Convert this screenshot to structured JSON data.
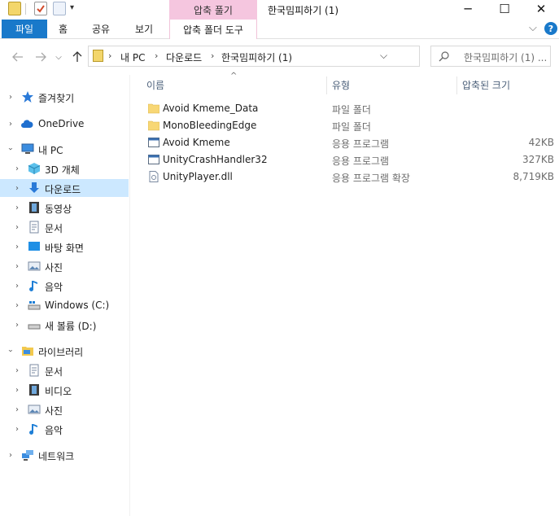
{
  "window": {
    "title": "한국밈피하기 (1)",
    "contextual_group": "압축 풀기",
    "controls": {
      "minimize": "─",
      "maximize": "☐",
      "close": "✕"
    }
  },
  "ribbon": {
    "tabs": [
      "파일",
      "홈",
      "공유",
      "보기"
    ],
    "context_tab": "압축 폴더 도구",
    "collapse_glyph": "⌵",
    "help_glyph": "?"
  },
  "address": {
    "crumbs": [
      "내 PC",
      "다운로드",
      "한국밈피하기 (1)"
    ],
    "separator": "›",
    "search_placeholder": "한국밈피하기 (1) ..."
  },
  "nav": {
    "quick_access": "즐겨찾기",
    "onedrive": "OneDrive",
    "this_pc": "내 PC",
    "pc_items": [
      "3D 개체",
      "다운로드",
      "동영상",
      "문서",
      "바탕 화면",
      "사진",
      "음악",
      "Windows (C:)",
      "새 볼륨 (D:)"
    ],
    "libraries": "라이브러리",
    "lib_items": [
      "문서",
      "비디오",
      "사진",
      "음악"
    ],
    "network": "네트워크"
  },
  "columns": {
    "name": "이름",
    "type": "유형",
    "size": "압축된 크기"
  },
  "files": [
    {
      "name": "Avoid Kmeme_Data",
      "type": "파일 폴더",
      "size": "",
      "icon": "folder-icon"
    },
    {
      "name": "MonoBleedingEdge",
      "type": "파일 폴더",
      "size": "",
      "icon": "folder-icon"
    },
    {
      "name": "Avoid Kmeme",
      "type": "응용 프로그램",
      "size": "42KB",
      "icon": "application-icon"
    },
    {
      "name": "UnityCrashHandler32",
      "type": "응용 프로그램",
      "size": "327KB",
      "icon": "application-icon"
    },
    {
      "name": "UnityPlayer.dll",
      "type": "응용 프로그램 확장",
      "size": "8,719KB",
      "icon": "dll-icon"
    }
  ],
  "colors": {
    "accent": "#1979ca",
    "selection": "#cce8ff",
    "context_tab": "#f5c6df",
    "folder": "#f8d775"
  }
}
